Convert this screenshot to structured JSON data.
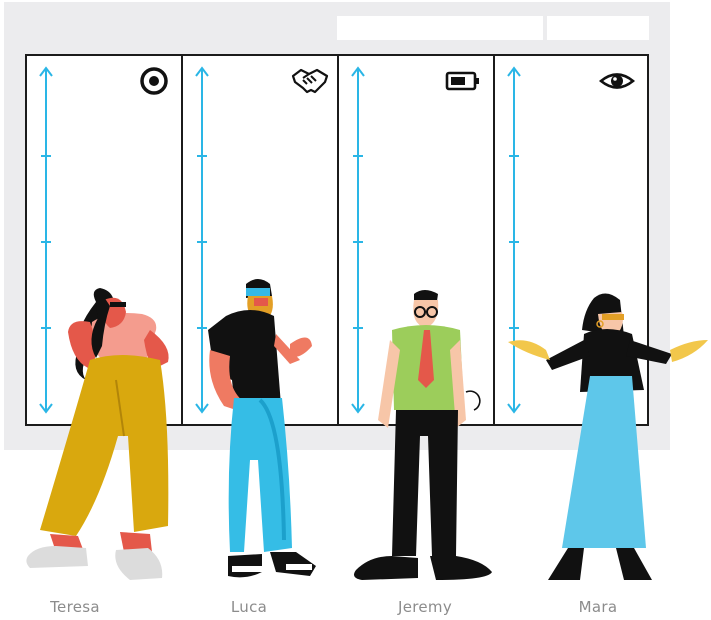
{
  "board": {
    "columns": [
      {
        "icon": "target-icon"
      },
      {
        "icon": "handshake-icon"
      },
      {
        "icon": "battery-icon"
      },
      {
        "icon": "eye-icon"
      }
    ]
  },
  "people": [
    {
      "name": "Teresa"
    },
    {
      "name": "Luca"
    },
    {
      "name": "Jeremy"
    },
    {
      "name": "Mara"
    }
  ],
  "colors": {
    "axis": "#2ab6e6",
    "border": "#1b1b1b",
    "backdrop": "#ececee"
  }
}
